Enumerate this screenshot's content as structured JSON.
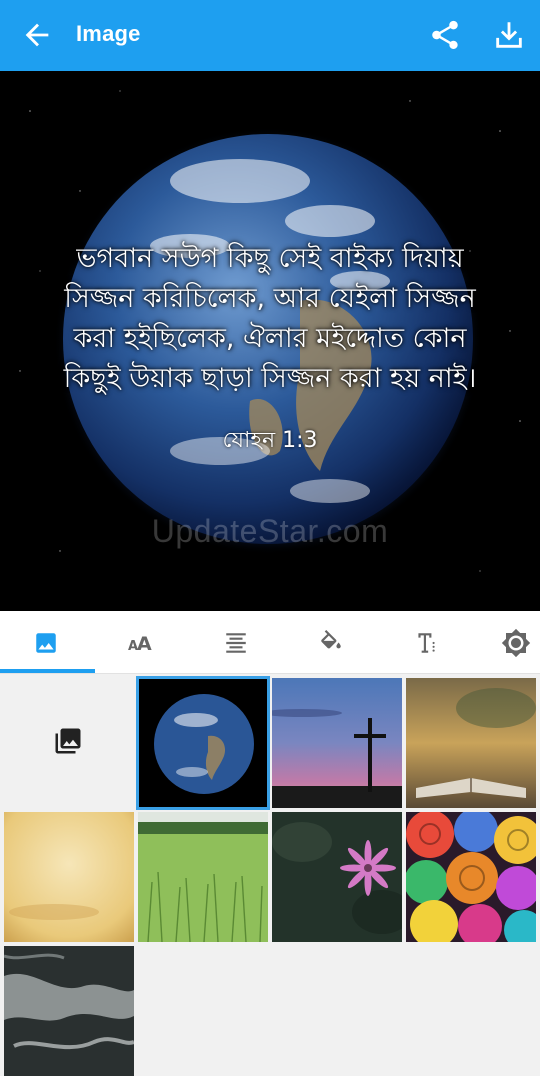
{
  "appbar": {
    "title": "Image",
    "back_icon": "arrow-back-icon",
    "share_icon": "share-icon",
    "download_icon": "download-icon",
    "color": "#1e9ff0"
  },
  "preview": {
    "verse_lines": [
      "ভগবান সউগ কিছু সেই বাইক্য দিয়ায়",
      "সিজ্জন করিচিলেক, আর যেইলা সিজ্জন",
      "করা হইছিলেক, ঐলার মইদ্দোত কোন",
      "কিছুই উয়াক ছাড়া সিজ্জন করা হয় নাই।"
    ],
    "reference": "যোহন 1:3",
    "watermark": "UpdateStar.com"
  },
  "tabs": [
    {
      "icon": "image-icon",
      "active": true
    },
    {
      "icon": "font-size-icon",
      "active": false
    },
    {
      "icon": "text-align-icon",
      "active": false
    },
    {
      "icon": "fill-color-icon",
      "active": false
    },
    {
      "icon": "text-style-icon",
      "active": false
    },
    {
      "icon": "settings-icon",
      "active": false
    }
  ],
  "gallery": {
    "picker_icon": "photo-library-icon",
    "thumbnails": [
      {
        "name": "earth",
        "selected": true
      },
      {
        "name": "cross-sunset",
        "selected": false
      },
      {
        "name": "open-bible",
        "selected": false
      },
      {
        "name": "parchment",
        "selected": false
      },
      {
        "name": "grass-field",
        "selected": false
      },
      {
        "name": "pink-flower",
        "selected": false
      },
      {
        "name": "rainbow-roses",
        "selected": false
      },
      {
        "name": "marble-texture",
        "selected": false
      }
    ]
  }
}
